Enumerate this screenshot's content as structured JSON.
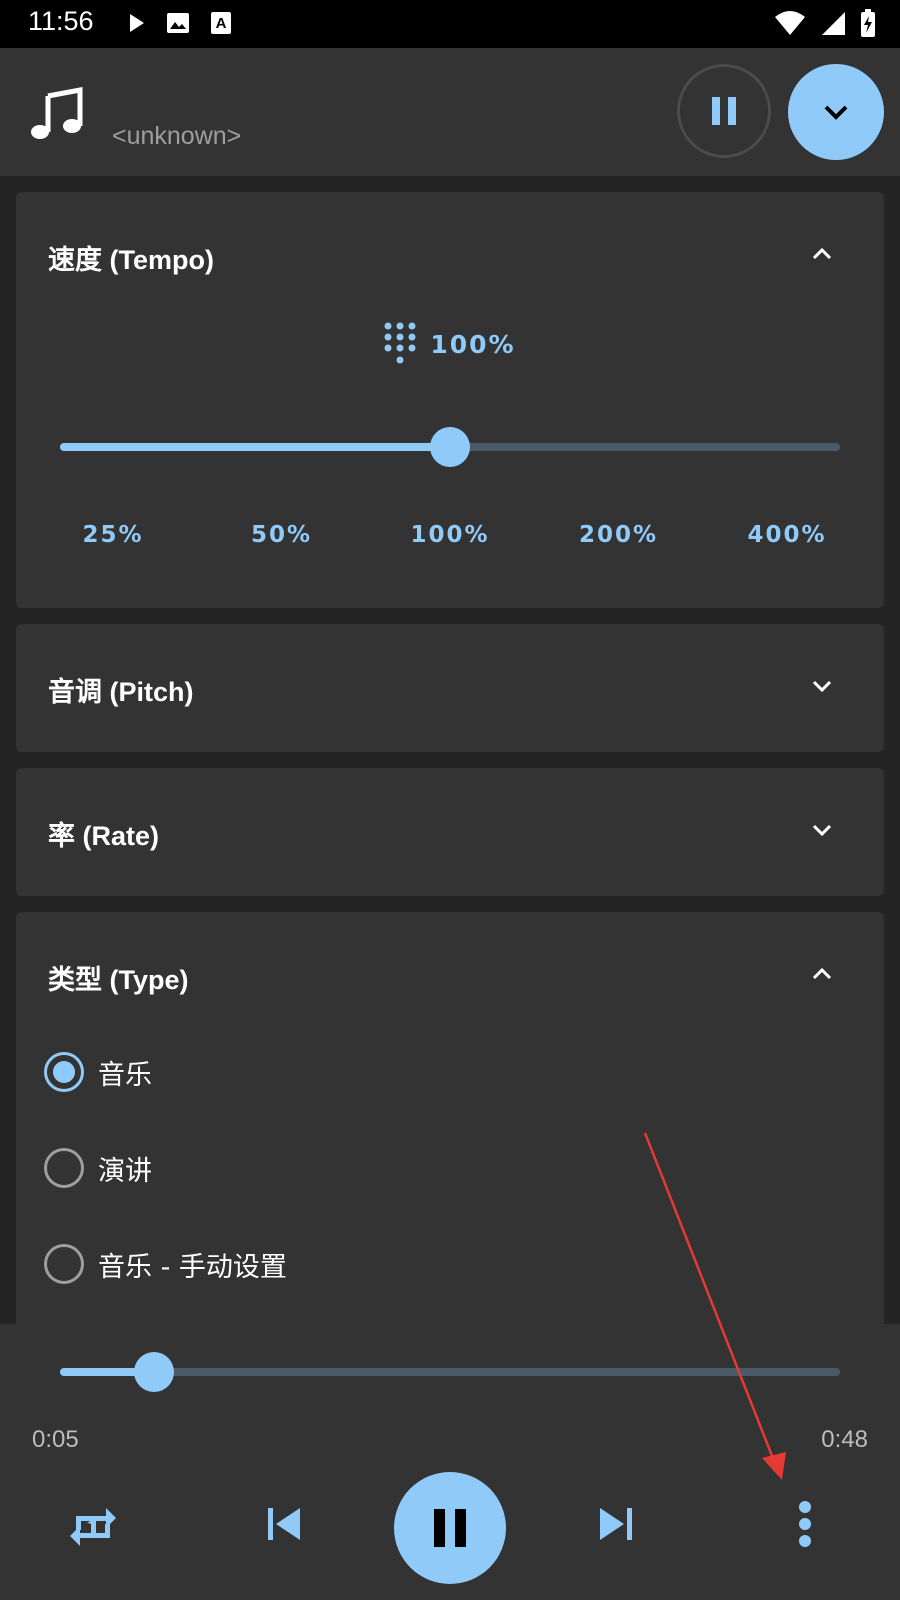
{
  "status_bar": {
    "time": "11:56",
    "left_icons": [
      "play-icon",
      "image-icon",
      "font-icon"
    ],
    "right_icons": [
      "wifi-icon",
      "signal-icon",
      "battery-charging-icon"
    ]
  },
  "header": {
    "track_title": "<unknown>",
    "icons": [
      "music-note-icon",
      "pause-icon",
      "chevron-down-icon"
    ]
  },
  "tempo": {
    "title": "速度 (Tempo)",
    "value": "100%",
    "slider_fraction": 0.5,
    "ticks": [
      "25%",
      "50%",
      "100%",
      "200%",
      "400%"
    ]
  },
  "pitch": {
    "title": "音调 (Pitch)"
  },
  "rate": {
    "title": "率 (Rate)"
  },
  "type": {
    "title": "类型 (Type)",
    "options": [
      {
        "label": "音乐",
        "checked": true
      },
      {
        "label": "演讲",
        "checked": false
      },
      {
        "label": "音乐 - 手动设置",
        "checked": false
      }
    ]
  },
  "player": {
    "elapsed": "0:05",
    "duration": "0:48",
    "progress_fraction": 0.12,
    "controls": [
      "repeat-one-icon",
      "skip-previous-icon",
      "pause-icon",
      "skip-next-icon",
      "more-vert-icon"
    ]
  },
  "colors": {
    "accent": "#90caf9",
    "card_bg": "#333333",
    "page_bg": "#242424",
    "annotation_arrow": "#e53935"
  }
}
